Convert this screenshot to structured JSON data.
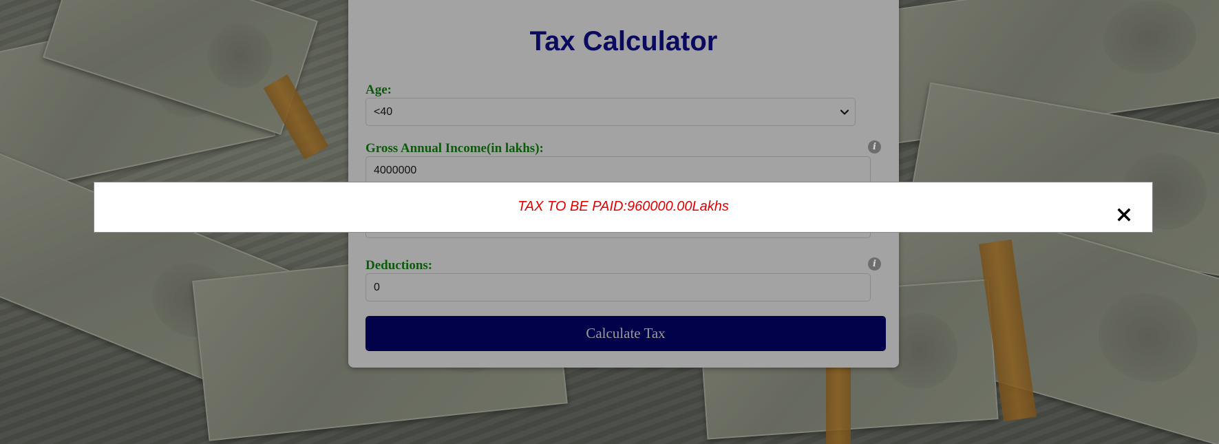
{
  "calculator": {
    "title": "Tax Calculator",
    "age": {
      "label": "Age:",
      "selected": "<40"
    },
    "gross_income": {
      "label": "Gross Annual Income(in lakhs):",
      "value": "4000000"
    },
    "deductions": {
      "label": "Deductions:",
      "value": "0"
    },
    "calculate_button": "Calculate Tax"
  },
  "result_modal": {
    "message": "TAX TO BE PAID:960000.00Lakhs",
    "close_icon": "close-icon"
  },
  "colors": {
    "title": "#0a0a5e",
    "label": "#0d5a0d",
    "button_bg": "#02024a",
    "result_text": "#e00000"
  }
}
